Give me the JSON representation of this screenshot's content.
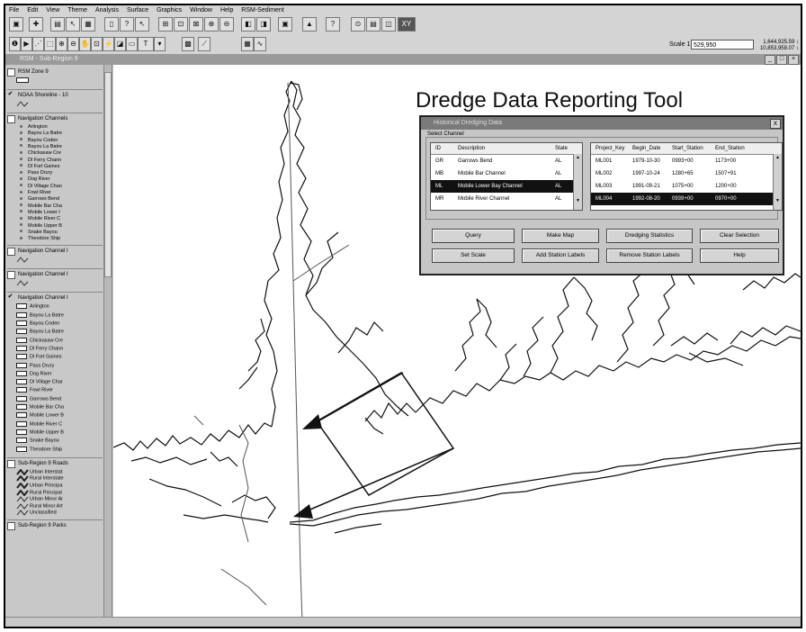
{
  "menu": [
    "File",
    "Edit",
    "View",
    "Theme",
    "Analysis",
    "Surface",
    "Graphics",
    "Window",
    "Help",
    "RSM-Sediment"
  ],
  "scale": {
    "label": "Scale 1:",
    "value": "529,950"
  },
  "coords": [
    "1,644,925.59 ↕",
    "10,853,958.07 ↕"
  ],
  "view_title": "RSM - Sub-Region 9",
  "toc": {
    "themes": [
      {
        "name": "RSM Zone 9",
        "checked": false
      },
      {
        "name": "NOAA Shoreline - 10",
        "checked": true
      },
      {
        "name": "Navigation Channels",
        "checked": false
      },
      {
        "name": "Navigation Channel I",
        "checked": false
      },
      {
        "name": "Navigation Channel I",
        "checked": false
      },
      {
        "name": "Navigation Channel I",
        "checked": true
      },
      {
        "name": "Sub-Region 9 Roads",
        "checked": false
      },
      {
        "name": "Sub-Region 9 Parks",
        "checked": false
      }
    ],
    "channels_a": [
      "Arlington",
      "Bayou La Batre",
      "Bayou Coden",
      "Bayou La Batre",
      "Chickasaw Cre",
      "Dl Ferry Chann",
      "Dl Fort Gaines",
      "Pass Drury",
      "Dog River",
      "Dl Village Chan",
      "Fowl River",
      "Garrows Bend",
      "Mobile Bar Cha",
      "Mobile Lower I",
      "Mobile River C",
      "Mobile Upper B",
      "Snake Bayou",
      "Theodore Ship"
    ],
    "channels_b": [
      "Arlington",
      "Bayou La Batre",
      "Bayou Coden",
      "Bayou La Batre",
      "Chickasaw Cre",
      "Dl Ferry Chann",
      "Dl Fort Gaines",
      "Pass Drury",
      "Dog River",
      "Dl Village Char",
      "Fowl River",
      "Garrows Bend",
      "Mobile Bar Cha",
      "Mobile Lower B",
      "Mobile River C",
      "Mobile Upper B",
      "Snake Bayou",
      "Theodore Ship"
    ],
    "roads": [
      "Urban Interstat",
      "Rural Interstate",
      "Urban Principa",
      "Rural Principal",
      "Urban Minor Ar",
      "Rural Minor Art",
      "Unclassified"
    ]
  },
  "tool_title": "Dredge Data Reporting Tool",
  "dialog": {
    "title": "Historical Dredging Data",
    "close": "x",
    "group_label": "Select Channel",
    "channel_headers": [
      "ID",
      "Description",
      "State"
    ],
    "channels": [
      {
        "id": "GR",
        "desc": "Garrows Bend",
        "state": "AL",
        "selected": false
      },
      {
        "id": "MB",
        "desc": "Mobile Bar Channel",
        "state": "AL",
        "selected": false
      },
      {
        "id": "ML",
        "desc": "Mobile Lower Bay Channel",
        "state": "AL",
        "selected": true
      },
      {
        "id": "MR",
        "desc": "Mobile River Channel",
        "state": "AL",
        "selected": false
      }
    ],
    "project_headers": [
      "Project_Key",
      "Begin_Date",
      "Start_Station",
      "End_Station"
    ],
    "projects": [
      {
        "key": "ML001",
        "begin": "1979-10-30",
        "start": "0993+00",
        "end": "1173+00",
        "selected": false
      },
      {
        "key": "ML002",
        "begin": "1997-10-24",
        "start": "1280+65",
        "end": "1507+91",
        "selected": false
      },
      {
        "key": "ML003",
        "begin": "1991-09-21",
        "start": "1075+00",
        "end": "1200+00",
        "selected": false
      },
      {
        "key": "ML004",
        "begin": "1992-08-20",
        "start": "0939+00",
        "end": "0970+00",
        "selected": true
      }
    ],
    "buttons": {
      "query": "Query",
      "make_map": "Make Map",
      "dredging_stats": "Dredging Statistics",
      "clear_selection": "Clear Selection",
      "set_scale": "Set Scale",
      "add_station_labels": "Add Station Labels",
      "remove_station_labels": "Remove Station Labels",
      "help": "Help"
    }
  },
  "toolbar_text": {
    "t_tool": "T",
    "xy": "XY"
  }
}
